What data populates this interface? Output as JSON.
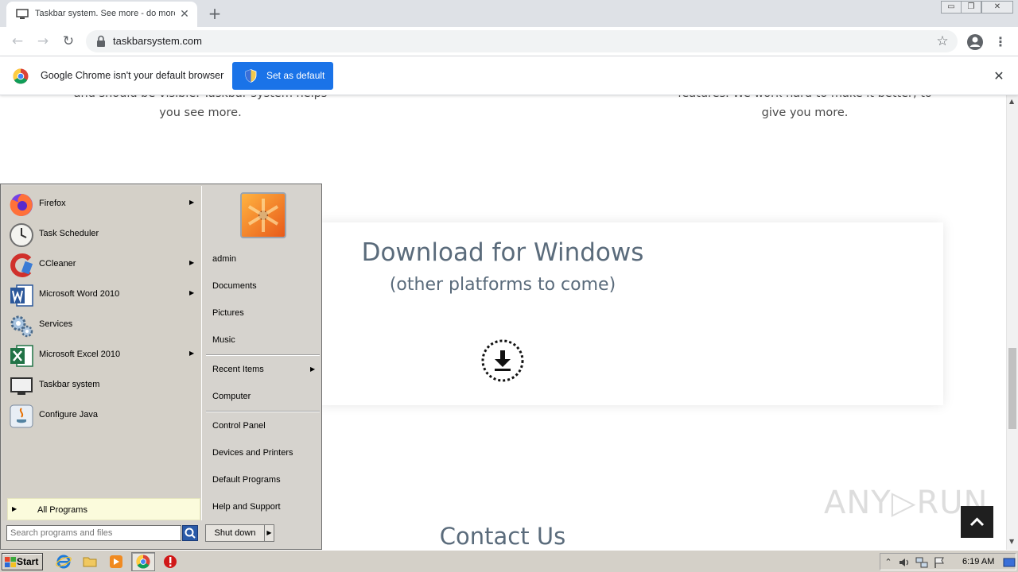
{
  "browser": {
    "tab_title": "Taskbar system. See more - do more",
    "tab_close": "✕",
    "new_tab": "+",
    "window_controls": {
      "minimize": "▭",
      "maximize": "❐",
      "close": "✕"
    },
    "nav": {
      "back": "←",
      "forward": "→",
      "reload": "↻"
    },
    "url": "taskbarsystem.com",
    "star": "☆",
    "menu": "⋮"
  },
  "infobar": {
    "message": "Google Chrome isn't your default browser",
    "button_label": "Set as default",
    "close": "✕"
  },
  "page": {
    "feature_left": "and should be visible. Taskbar system helps you see more.",
    "feature_right": "features. We work hard to make it better, to give you more.",
    "download_title": "Download for Windows",
    "download_subtitle": "(other platforms to come)",
    "contact_title": "Contact Us",
    "watermark": "ANY▷RUN"
  },
  "scrollbar": {
    "up": "▲",
    "down": "▼"
  },
  "start_menu": {
    "programs": [
      {
        "label": "Firefox",
        "icon": "firefox-icon",
        "has_submenu": true
      },
      {
        "label": "Task Scheduler",
        "icon": "clock-icon",
        "has_submenu": false
      },
      {
        "label": "CCleaner",
        "icon": "ccleaner-icon",
        "has_submenu": true
      },
      {
        "label": "Microsoft Word 2010",
        "icon": "word-icon",
        "has_submenu": true
      },
      {
        "label": "Services",
        "icon": "gears-icon",
        "has_submenu": false
      },
      {
        "label": "Microsoft Excel 2010",
        "icon": "excel-icon",
        "has_submenu": true
      },
      {
        "label": "Taskbar system",
        "icon": "monitor-icon",
        "has_submenu": false
      },
      {
        "label": "Configure Java",
        "icon": "java-icon",
        "has_submenu": false
      }
    ],
    "submenu_arrow": "▶",
    "all_programs": "All Programs",
    "search_placeholder": "Search programs and files",
    "places": [
      {
        "label": "admin"
      },
      {
        "label": "Documents"
      },
      {
        "label": "Pictures"
      },
      {
        "label": "Music"
      },
      {
        "label": "Recent Items",
        "has_submenu": true
      },
      {
        "label": "Computer"
      },
      {
        "label": "Control Panel"
      },
      {
        "label": "Devices and Printers"
      },
      {
        "label": "Default Programs"
      },
      {
        "label": "Help and Support"
      }
    ],
    "shutdown": "Shut down",
    "shutdown_arrow": "▶"
  },
  "taskbar": {
    "start_label": "Start",
    "tray_expand": "⌃",
    "clock": "6:19 AM"
  }
}
